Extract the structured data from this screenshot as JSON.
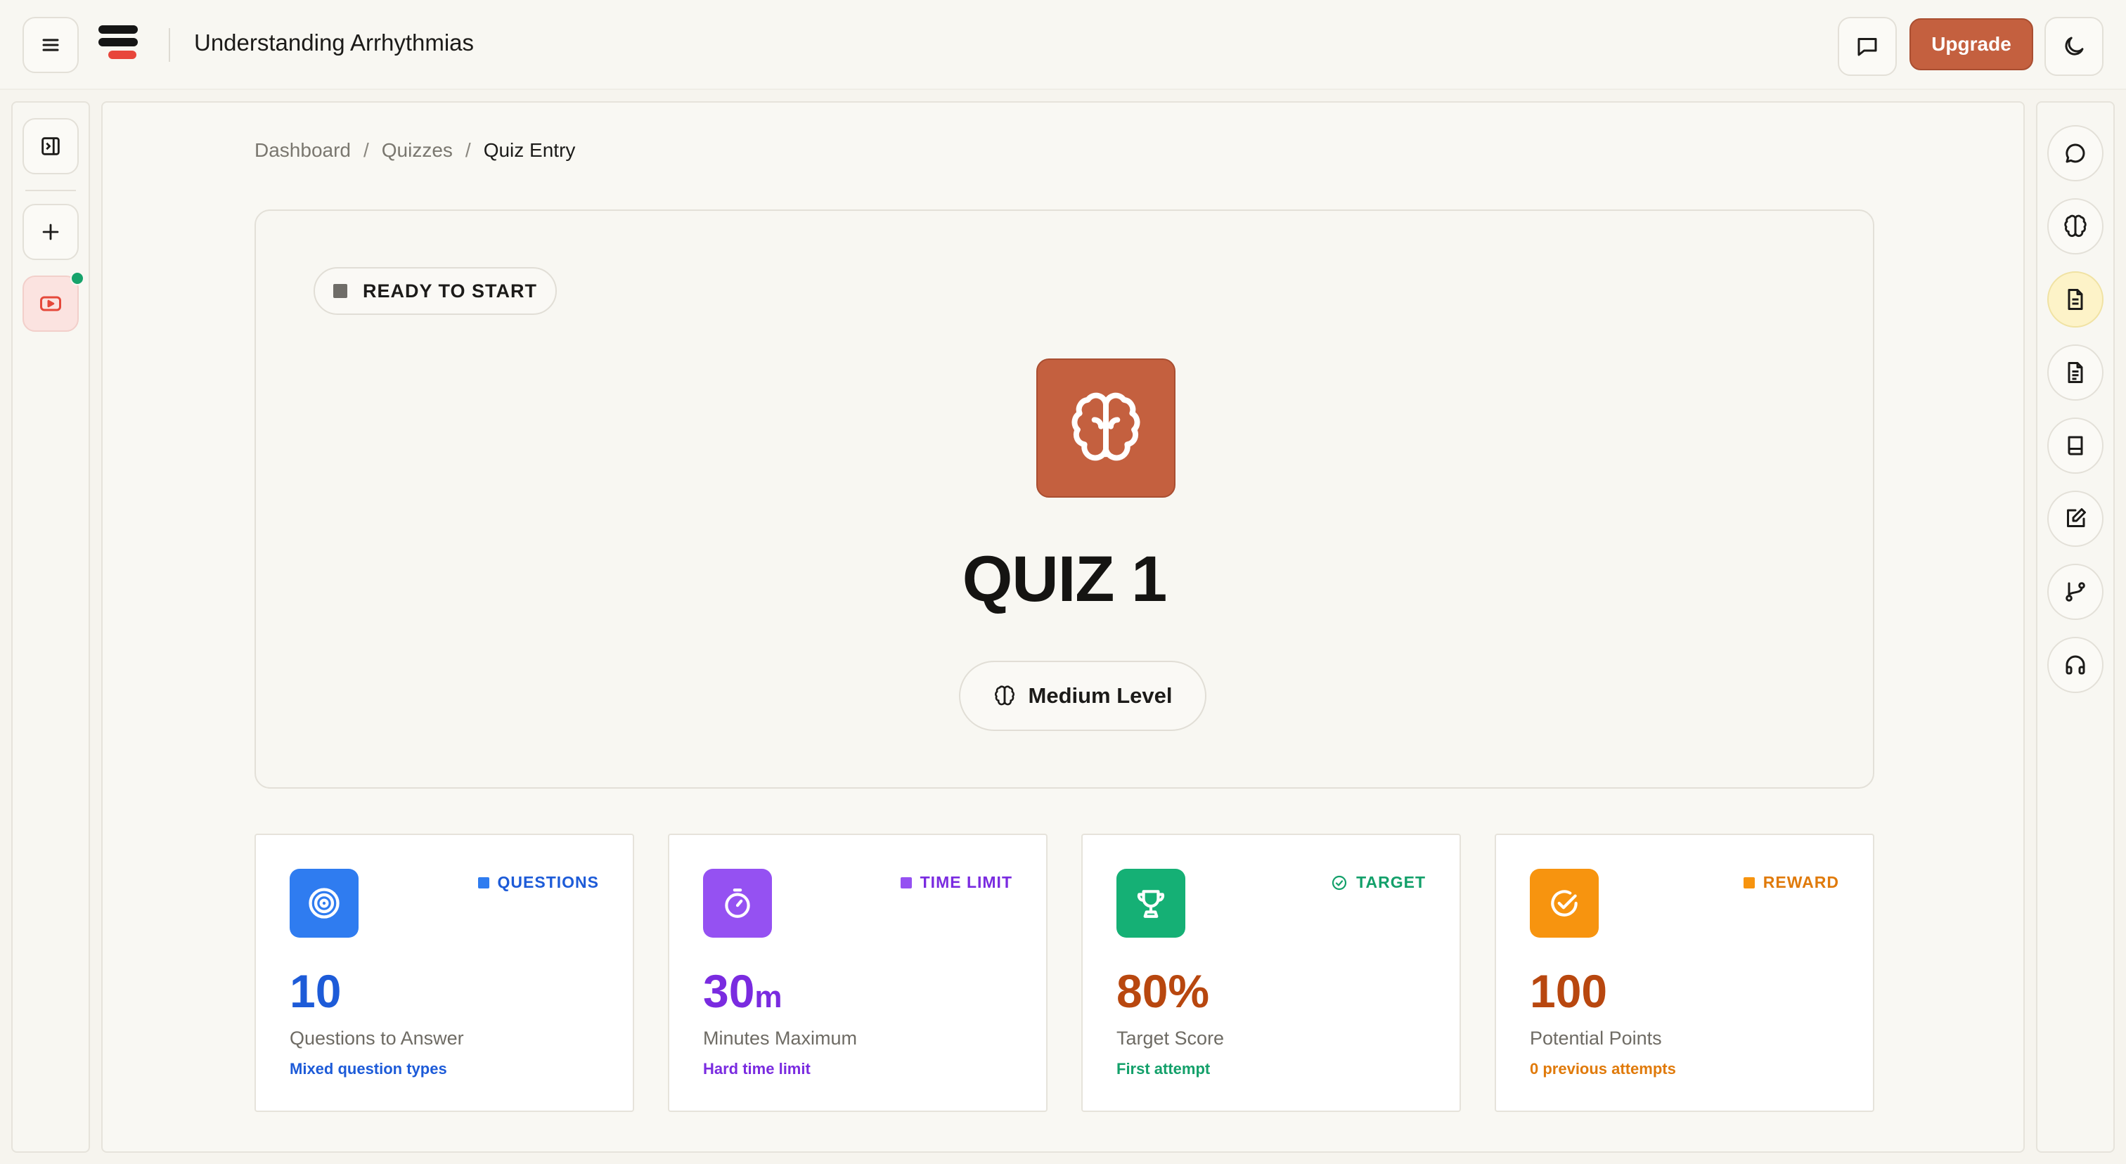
{
  "app": {
    "title": "Understanding Arrhythmias",
    "upgrade_label": "Upgrade"
  },
  "topbar": {
    "icons": [
      "menu-icon",
      "logo-icon",
      "chat-icon",
      "moon-icon"
    ]
  },
  "left_rail": {
    "icons": [
      "sidebar-toggle-icon",
      "plus-icon",
      "youtube-icon"
    ],
    "notification_color": "#16a36b"
  },
  "breadcrumb": {
    "items": [
      "Dashboard",
      "Quizzes",
      "Quiz Entry"
    ],
    "separator": "/"
  },
  "quiz": {
    "status": "READY TO START",
    "title": "QUIZ 1",
    "level": "Medium Level",
    "icon": "brain-icon",
    "accent": "#c4603f"
  },
  "stats": [
    {
      "tag": "QUESTIONS",
      "value": "10",
      "unit": "",
      "label": "Questions to Answer",
      "sub": "Mixed question types",
      "color": "#1d5bd8",
      "icon_bg": "#2f7cf0",
      "icon": "target-icon"
    },
    {
      "tag": "TIME LIMIT",
      "value": "30",
      "unit": "m",
      "label": "Minutes Maximum",
      "sub": "Hard time limit",
      "color": "#7a2be0",
      "icon_bg": "#9551f2",
      "icon": "timer-icon"
    },
    {
      "tag": "TARGET",
      "value": "80%",
      "unit": "",
      "label": "Target Score",
      "sub": "First attempt",
      "color": "#13a06a",
      "value_color": "#b8470f",
      "icon_bg": "#15b075",
      "icon": "trophy-icon"
    },
    {
      "tag": "REWARD",
      "value": "100",
      "unit": "",
      "label": "Potential Points",
      "sub": "0 previous attempts",
      "color": "#e07a0a",
      "value_color": "#b8470f",
      "icon_bg": "#f7940f",
      "icon": "check-circle-icon"
    }
  ],
  "right_rail": {
    "icons": [
      "chat-bubble-icon",
      "brain-icon",
      "notes-icon",
      "document-icon",
      "book-icon",
      "edit-icon",
      "branch-icon",
      "headphones-icon"
    ],
    "active": "notes-icon"
  }
}
